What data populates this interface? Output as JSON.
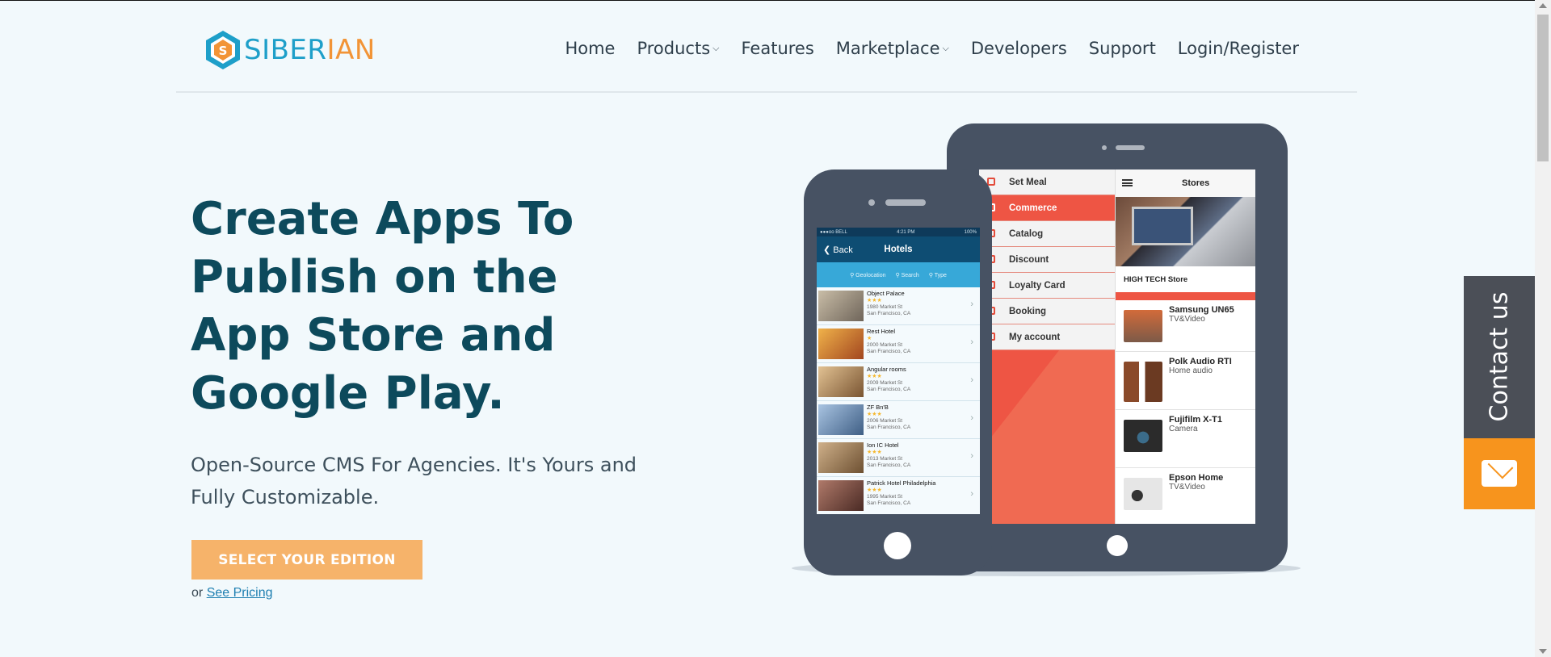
{
  "brand": {
    "name_part1": "SIBER",
    "name_part2": "IAN",
    "logo_icon": "s-hexagon-logo-icon",
    "color_primary": "#1e9fc9",
    "color_accent": "#f29436"
  },
  "nav": {
    "items": [
      {
        "label": "Home",
        "has_dropdown": false
      },
      {
        "label": "Products",
        "has_dropdown": true
      },
      {
        "label": "Features",
        "has_dropdown": false
      },
      {
        "label": "Marketplace",
        "has_dropdown": true
      },
      {
        "label": "Developers",
        "has_dropdown": false
      },
      {
        "label": "Support",
        "has_dropdown": false
      },
      {
        "label": "Login/Register",
        "has_dropdown": false
      }
    ],
    "dropdown_icon": "chevron-down-icon"
  },
  "hero": {
    "title": "Create Apps To Publish on the App Store and Google Play.",
    "subtitle": "Open-Source CMS For Agencies. It's Yours and Fully Customizable.",
    "cta_label": "SELECT YOUR EDITION",
    "or_text": "or",
    "pricing_link": "See Pricing",
    "cta_color": "#f6b36a"
  },
  "tablet": {
    "menu": [
      {
        "label": "Set Meal",
        "active": false
      },
      {
        "label": "Commerce",
        "active": true
      },
      {
        "label": "Catalog",
        "active": false
      },
      {
        "label": "Discount",
        "active": false
      },
      {
        "label": "Loyalty Card",
        "active": false
      },
      {
        "label": "Booking",
        "active": false
      },
      {
        "label": "My account",
        "active": false
      }
    ],
    "stores_title": "Stores",
    "store_name": "HIGH TECH Store",
    "products": [
      {
        "name": "Samsung UN65",
        "category": "TV&Video",
        "thumb_color": "#7c5a48"
      },
      {
        "name": "Polk Audio RTI",
        "category": "Home audio",
        "thumb_color": "#8a4a2a"
      },
      {
        "name": "Fujifilm X-T1",
        "category": "Camera",
        "thumb_color": "#2b2b2b"
      },
      {
        "name": "Epson Home",
        "category": "TV&Video",
        "thumb_color": "#dcdcdc"
      }
    ]
  },
  "phone": {
    "status_left": "●●●oo BELL",
    "status_time": "4:21 PM",
    "status_right": "100%",
    "back_label": "Back",
    "title": "Hotels",
    "filters": [
      "Geolocation",
      "Search",
      "Type"
    ],
    "hotels": [
      {
        "name": "Object Palace",
        "stars": "★★★",
        "street": "1980 Market St",
        "city": "San Francisco, CA",
        "thumb_color": "#9c8f7a"
      },
      {
        "name": "Rest Hotel",
        "stars": "★",
        "street": "2000 Market St",
        "city": "San Francisco, CA",
        "thumb_color": "#d08a2f"
      },
      {
        "name": "Angular rooms",
        "stars": "★★★",
        "street": "2009 Market St",
        "city": "San Francisco, CA",
        "thumb_color": "#b08a5e"
      },
      {
        "name": "ZF Bn'B",
        "stars": "★★★",
        "street": "2006 Market St",
        "city": "San Francisco, CA",
        "thumb_color": "#5f7fa5"
      },
      {
        "name": "Ion IC Hotel",
        "stars": "★★★",
        "street": "2013 Market St",
        "city": "San Francisco, CA",
        "thumb_color": "#9a7b56"
      },
      {
        "name": "Patrick Hotel Philadelphia",
        "stars": "★★★",
        "street": "1995 Market St",
        "city": "San Francisco, CA",
        "thumb_color": "#7a4a3e"
      }
    ]
  },
  "contact": {
    "label": "Contact us",
    "icon": "envelope-icon",
    "panel_color": "#4b4f57",
    "icon_bg": "#f7941d"
  }
}
